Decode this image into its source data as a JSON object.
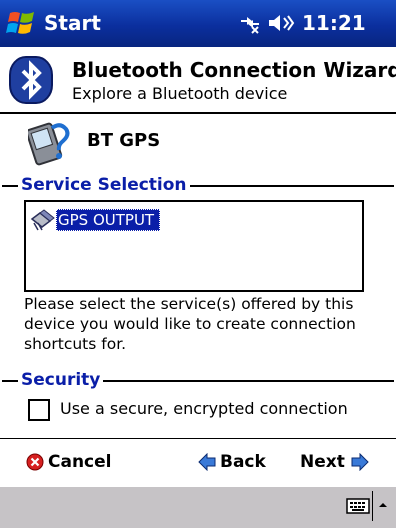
{
  "taskbar": {
    "start_label": "Start",
    "time": "11:21"
  },
  "wizard": {
    "title": "Bluetooth Connection Wizard",
    "subtitle": "Explore a Bluetooth device"
  },
  "device": {
    "name": "BT GPS"
  },
  "service_selection": {
    "heading": "Service Selection",
    "items": [
      {
        "label": "GPS OUTPUT",
        "selected": true
      }
    ],
    "description": "Please select the service(s) offered by this device you would like to create connection shortcuts for."
  },
  "security": {
    "heading": "Security",
    "checkbox_label": "Use a secure, encrypted connection",
    "checked": false
  },
  "nav": {
    "cancel_label": "Cancel",
    "back_label": "Back",
    "next_label": "Next"
  },
  "colors": {
    "taskbar": "#0b2f9e",
    "selection": "#0a1ea8",
    "group_heading": "#0a1ea8",
    "command_bar": "#c6c3c6"
  }
}
